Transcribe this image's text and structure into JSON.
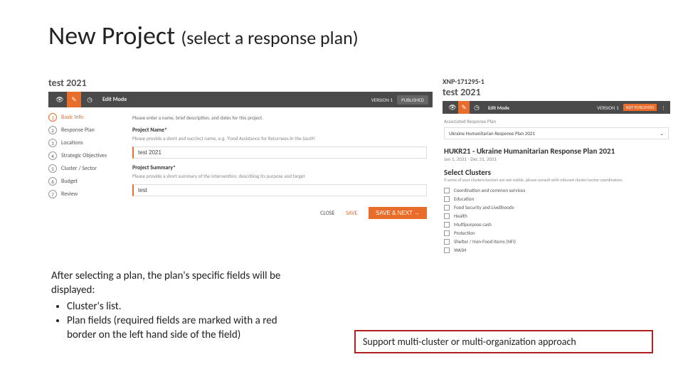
{
  "title": {
    "main": "New Project",
    "sub": "(select a response plan)"
  },
  "panelLeft": {
    "heading": "test 2021",
    "toolbar": {
      "editMode": "Edit Mode",
      "version": "VERSION 1",
      "status": "PUBLISHED"
    },
    "steps": [
      "Basic Info",
      "Response Plan",
      "Locations",
      "Strategic Objectives",
      "Cluster / Sector",
      "Budget",
      "Review"
    ],
    "form": {
      "intro": "Please enter a name, brief description, and dates for this project.",
      "nameLabel": "Project Name*",
      "nameHelp": "Please provide a short and succinct name, e.g. 'Food Assistance for Returnees in the South'",
      "nameValue": "test 2021",
      "summaryLabel": "Project Summary*",
      "summaryHelp": "Please provide a short summary of the intervention, describing its purpose and target",
      "summaryValue": "test"
    },
    "actions": {
      "close": "CLOSE",
      "save": "SAVE",
      "saveNext": "SAVE & NEXT →"
    }
  },
  "panelRight": {
    "code": "XNP-171295-1",
    "heading": "test 2021",
    "toolbar": {
      "editMode": "Edit Mode",
      "version": "VERSION 1",
      "status": "NOT PUBLISHED"
    },
    "assocLabel": "Associated Response Plan",
    "dropdown": "Ukraine Humanitarian Response Plan 2021",
    "planTitle": "HUKR21 - Ukraine Humanitarian Response Plan 2021",
    "planRange": "Jan 1, 2021 - Dec 31, 2021",
    "selClustersTitle": "Select Clusters",
    "selClustersHelp": "If some of your clusters/sectors are not visible, please consult with relevant cluster/sector coordinators.",
    "clusters": [
      "Coordination and common services",
      "Education",
      "Food Security and Livelihoods",
      "Health",
      "Multipurpose cash",
      "Protection",
      "Shelter / Non-Food Items (NFI)",
      "WASH"
    ]
  },
  "noteLeft": {
    "intro": "After selecting a plan, the plan's specific fields will be displayed:",
    "b1": "Cluster's list.",
    "b2": "Plan fields (required fields are marked with a red border on the left hand side of the field)"
  },
  "noteRight": "Support multi-cluster or multi-organization approach"
}
